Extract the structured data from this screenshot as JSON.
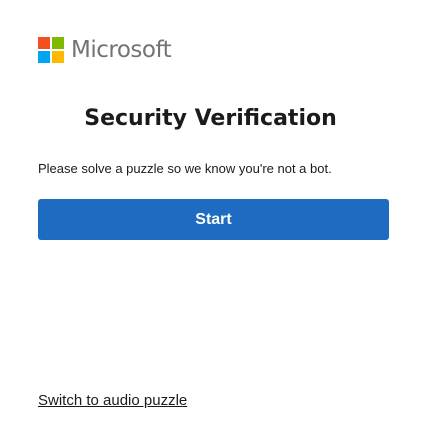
{
  "brand": {
    "name": "Microsoft",
    "logo_colors": {
      "top_left": "#f25022",
      "top_right": "#7fba00",
      "bottom_left": "#00a4ef",
      "bottom_right": "#ffb900"
    }
  },
  "header": {
    "title": "Security Verification"
  },
  "main": {
    "instructions": "Please solve a puzzle so we know you're not a bot.",
    "start_label": "Start",
    "audio_link_label": "Switch to audio puzzle"
  },
  "colors": {
    "primary_button": "#1e6cc1",
    "text": "#1b1b1b",
    "brand_text": "#737373"
  }
}
